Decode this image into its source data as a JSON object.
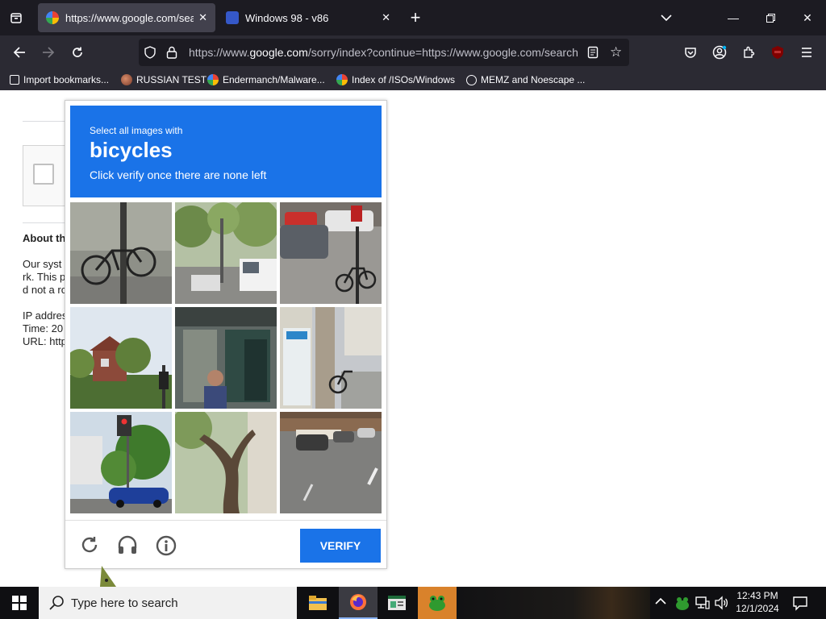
{
  "browser": {
    "tabs": [
      {
        "title": "https://www.google.com/searc",
        "active": true
      },
      {
        "title": "Windows 98 - v86",
        "active": false
      }
    ],
    "url_prefix": "https://www.",
    "url_domain": "google.com",
    "url_rest": "/sorry/index?continue=https://www.google.com/search",
    "bookmarks": [
      {
        "label": "Import bookmarks...",
        "icon": "import-icon"
      },
      {
        "label": "RUSSIAN TEST",
        "icon": "site-icon"
      },
      {
        "label": "Endermanch/Malware...",
        "icon": "google-icon"
      },
      {
        "label": "Index of /ISOs/Windows",
        "icon": "google-icon"
      },
      {
        "label": "MEMZ and Noescape ...",
        "icon": "globe-icon"
      }
    ]
  },
  "page": {
    "about_label": "About th",
    "lines": [
      "Our syst",
      "rk. This p",
      "d not a ro"
    ],
    "ip_label": "IP addres",
    "time_label": "Time: 20",
    "url_label": "URL: http"
  },
  "captcha": {
    "instruction": "Select all images with",
    "target": "bicycles",
    "subtext": "Click verify once there are none left",
    "verify_label": "VERIFY",
    "tiles": [
      "bicycle-on-pole",
      "street-with-van",
      "street-with-bicycle",
      "houses-and-trees",
      "storefront-window",
      "sidewalk-with-bicycle",
      "traffic-light-and-car",
      "tree-trunk",
      "street-with-parked-cars"
    ]
  },
  "taskbar": {
    "search_placeholder": "Type here to search",
    "time": "12:43 PM",
    "date": "12/1/2024"
  },
  "colors": {
    "captcha_blue": "#1a73e8",
    "tabbar_bg": "#1c1b22",
    "toolbar_bg": "#2b2a33"
  }
}
